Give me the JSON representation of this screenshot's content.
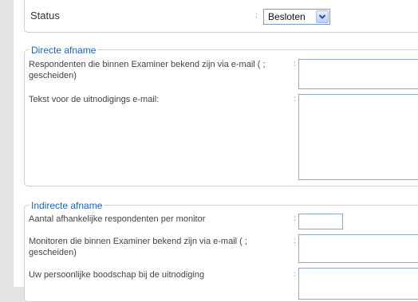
{
  "status": {
    "label": "Status",
    "colon": ":",
    "selected": "Besloten"
  },
  "direct": {
    "legend": "Directe afname",
    "respondents_label": "Respondenten die binnen Examiner bekend zijn via e-mail ( ; gescheiden)",
    "invite_text_label": "Tekst voor de uitnodigings e-mail:",
    "colon": ":"
  },
  "indirect": {
    "legend": "Indirecte afname",
    "count_label": "Aantal afhankelijke respondenten per monitor",
    "monitors_label": "Monitoren die binnen Examiner bekend zijn via e-mail ( ; gescheiden)",
    "message_label": "Uw persoonlijke boodschap bij de uitnodiging",
    "colon": ":"
  }
}
